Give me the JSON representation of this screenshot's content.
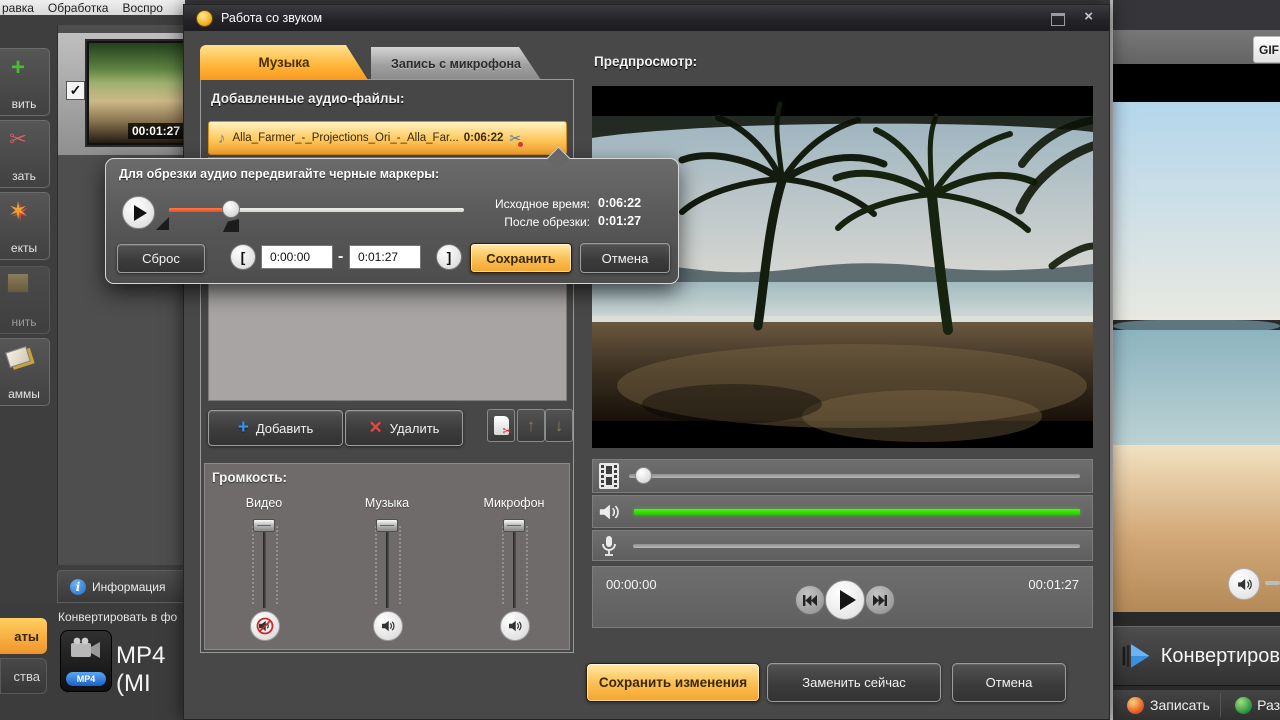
{
  "colors": {
    "accent_orange": "#f5a52c",
    "green_volume_bar": "#35e000",
    "mute_red": "#cc2a2a",
    "info_blue": "#1f6dc2",
    "mp4_badge_blue": "#1a5fc8"
  },
  "icons": {
    "plus": "+",
    "delete_cross": "✕",
    "scissors": "✂",
    "star": "✶",
    "music_note": "♪",
    "arrow_up": "↑",
    "arrow_down": "↓",
    "check": "✓",
    "info": "i",
    "window_close": "×"
  },
  "background_app": {
    "menu_items": [
      "равка",
      "Обработка",
      "Воспро"
    ],
    "toolbar_items": [
      {
        "label": "вить"
      },
      {
        "label": "зать"
      },
      {
        "label": "екты"
      },
      {
        "label": "нить"
      },
      {
        "label": "аммы"
      }
    ],
    "clip_time": "00:01:27",
    "info_button": "Информация",
    "formats_tab": "аты",
    "devices_tab": "ства",
    "convert_header": "Конвертировать в фо",
    "format_name": "MP4 (MI",
    "format_badge": "MP4",
    "gif_button": "GIF",
    "convert_button": "Конвертиров",
    "record_button": "Записать",
    "publish_button": "Раз"
  },
  "dialog": {
    "title": "Работа со звуком",
    "tabs": [
      {
        "label": "Музыка",
        "active": true
      },
      {
        "label": "Запись с микрофона",
        "active": false
      }
    ],
    "files_header": "Добавленные аудио-файлы:",
    "file_name": "Alla_Farmer_-_Projections_Ori_-_Alla_Far...",
    "file_duration": "0:06:22",
    "add_button": "Добавить",
    "delete_button": "Удалить",
    "volume_header": "Громкость:",
    "volume_channels": [
      {
        "label": "Видео",
        "muted": true
      },
      {
        "label": "Музыка",
        "muted": false
      },
      {
        "label": "Микрофон",
        "muted": false
      }
    ],
    "preview_header": "Предпросмотр:",
    "current_time": "00:00:00",
    "total_time": "00:01:27",
    "save_changes_button": "Сохранить изменения",
    "replace_button": "Заменить сейчас",
    "cancel_button": "Отмена"
  },
  "trim_popup": {
    "title": "Для обрезки аудио передвигайте черные маркеры:",
    "source_label": "Исходное время:",
    "source_time": "0:06:22",
    "result_label": "После обрезки:",
    "result_time": "0:01:27",
    "reset_button": "Сброс",
    "bracket_open": "[",
    "bracket_close": "]",
    "range_start": "0:00:00",
    "range_separator": "-",
    "range_end": "0:01:27",
    "save_button": "Сохранить",
    "cancel_button": "Отмена"
  }
}
